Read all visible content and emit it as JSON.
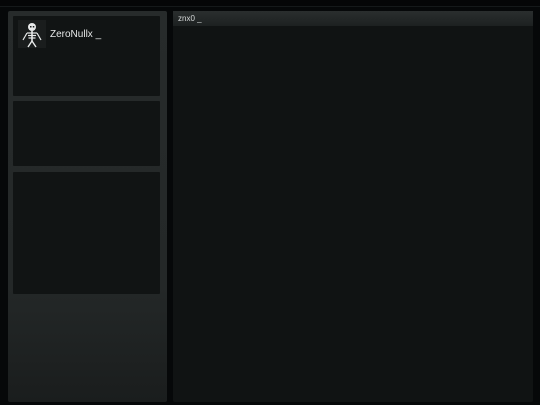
{
  "profile": {
    "username": "ZeroNullx _",
    "avatar_icon": "skeleton-icon"
  },
  "main": {
    "title": "znx0 _"
  },
  "colors": {
    "background": "#060809",
    "panel": "#111414",
    "sidebar": "#262a2a",
    "text": "#e6e8e8"
  }
}
